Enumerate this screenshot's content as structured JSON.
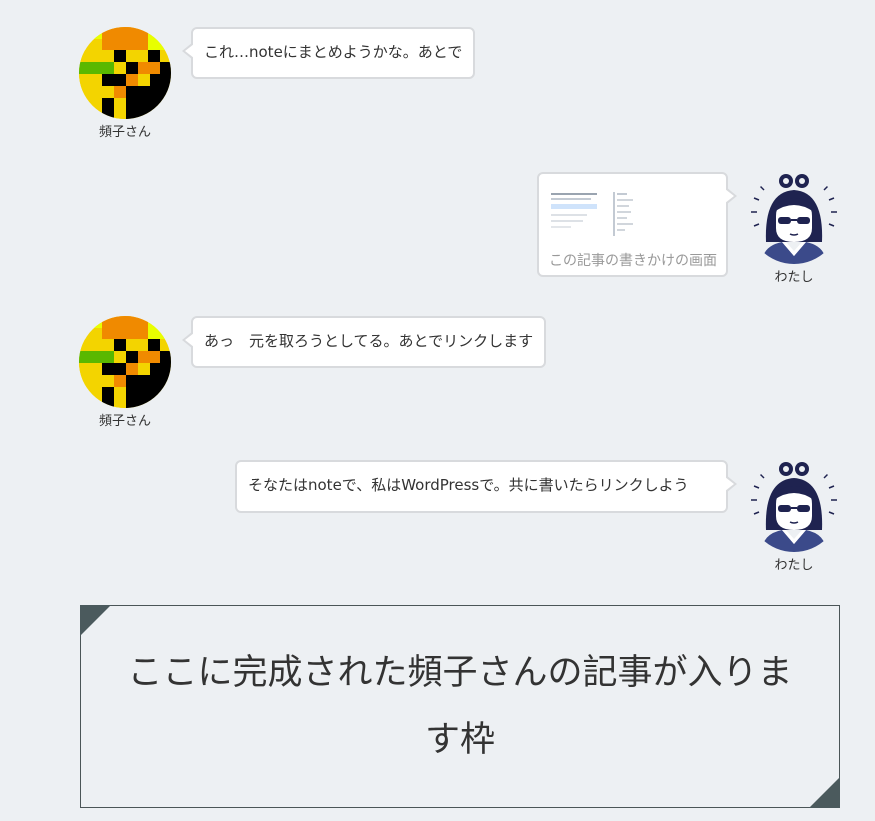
{
  "conversation": [
    {
      "side": "left",
      "speaker": "頻子さん",
      "avatar_icon": "pixel-art-avatar-icon",
      "text": "これ…noteにまとめようかな。あとで"
    },
    {
      "side": "right",
      "speaker": "わたし",
      "avatar_icon": "sunglasses-character-avatar-icon",
      "image_alt": "article-draft-screenshot-thumbnail",
      "caption": "この記事の書きかけの画面"
    },
    {
      "side": "left",
      "speaker": "頻子さん",
      "avatar_icon": "pixel-art-avatar-icon",
      "text": "あっ　元を取ろうとしてる。あとでリンクします"
    },
    {
      "side": "right",
      "speaker": "わたし",
      "avatar_icon": "sunglasses-character-avatar-icon",
      "text": "そなたはnoteで、私はWordPressで。共に書いたらリンクしよう"
    }
  ],
  "article_box": {
    "text": "ここに完成された頻子さんの記事が入ります枠"
  },
  "colors": {
    "background": "#edf0f3",
    "bubble_border": "#d8dadd",
    "box_border": "#4b5557",
    "corner": "#4b5a5d",
    "caption": "#999999"
  }
}
